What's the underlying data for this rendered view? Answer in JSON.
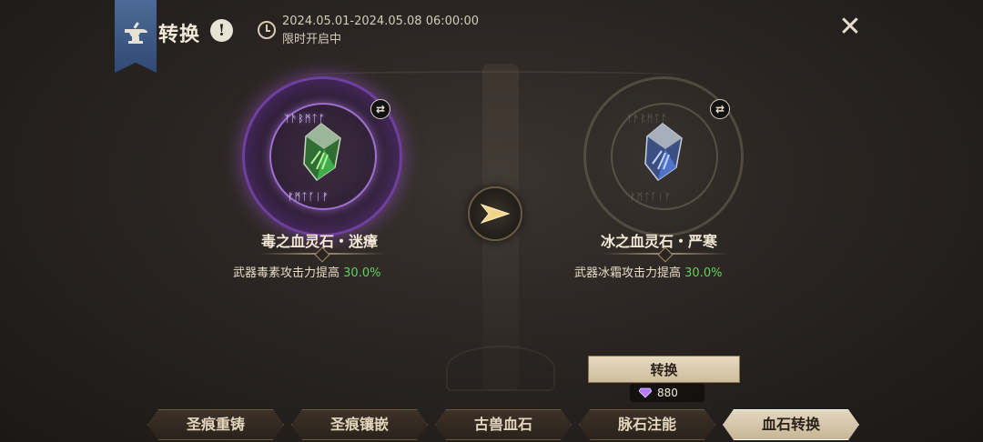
{
  "header": {
    "title": "转换",
    "info_symbol": "!",
    "date_range": "2024.05.01-2024.05.08 06:00:00",
    "limited_note": "限时开启中",
    "close_symbol": "✕"
  },
  "source_stone": {
    "name": "毒之血灵石・迷瘴",
    "desc_prefix": "武器毒素攻击力提高",
    "desc_value": "30.0%",
    "swap_symbol": "⇄",
    "gem_color": "#3fae4a",
    "ring_color": "#8a4fd0"
  },
  "target_stone": {
    "name": "冰之血灵石・严寒",
    "desc_prefix": "武器冰霜攻击力提高",
    "desc_value": "30.0%",
    "swap_symbol": "⇄",
    "gem_color": "#4f73c9"
  },
  "convert": {
    "button_label": "转换",
    "cost": "880",
    "currency_icon": "diamond-icon"
  },
  "tabs": [
    {
      "label": "圣痕重铸",
      "active": false
    },
    {
      "label": "圣痕镶嵌",
      "active": false
    },
    {
      "label": "古兽血石",
      "active": false
    },
    {
      "label": "脉石注能",
      "active": false
    },
    {
      "label": "血石转换",
      "active": true
    }
  ]
}
